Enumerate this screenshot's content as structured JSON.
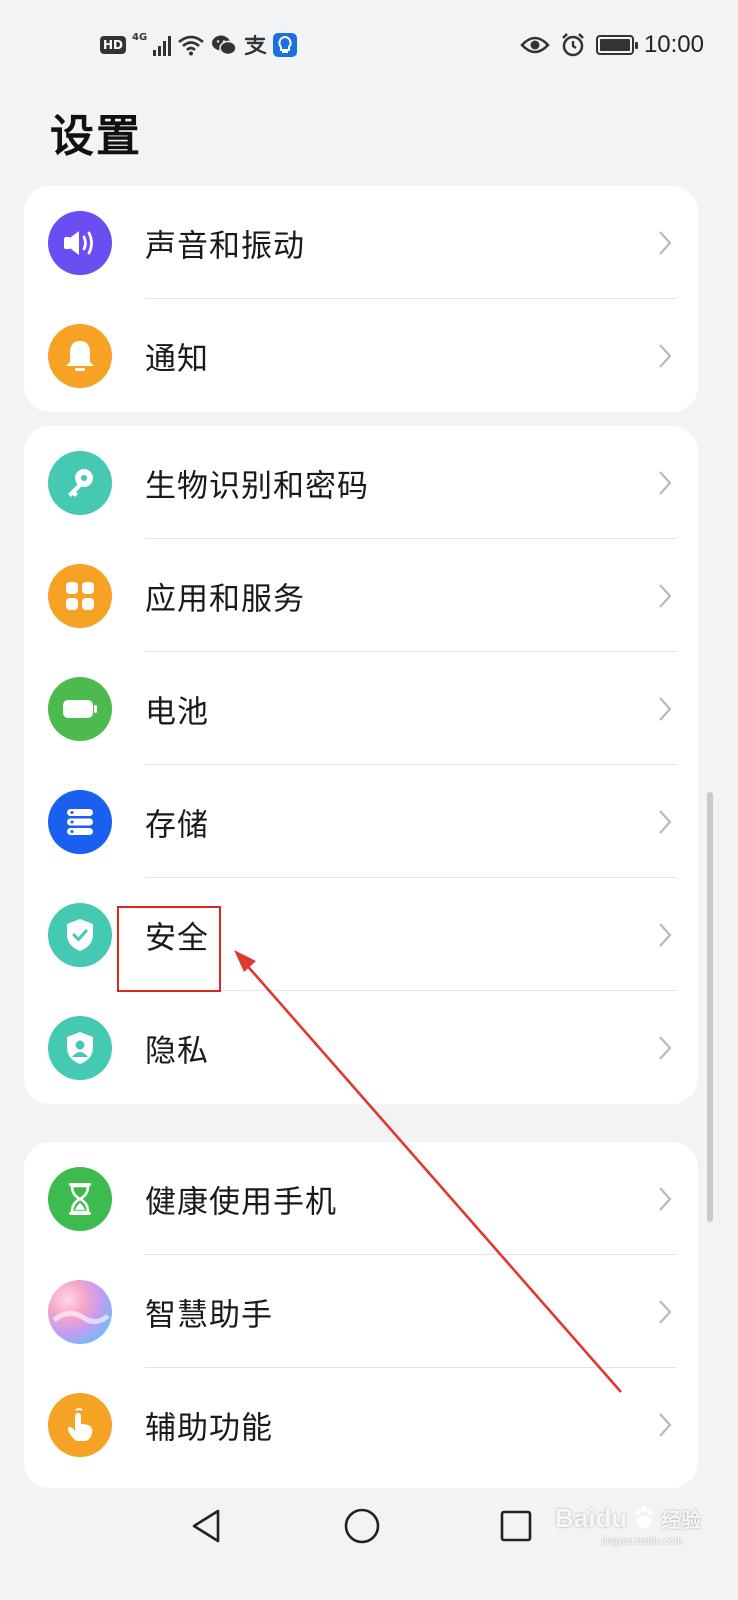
{
  "status_bar": {
    "hd_badge": "HD",
    "network": "4G",
    "time": "10:00"
  },
  "page": {
    "title": "设置"
  },
  "groups": [
    {
      "items": [
        {
          "label": "声音和振动",
          "icon": "speaker-icon",
          "color": "#6a4ef2"
        },
        {
          "label": "通知",
          "icon": "bell-icon",
          "color": "#f6a224"
        }
      ]
    },
    {
      "items": [
        {
          "label": "生物识别和密码",
          "icon": "key-icon",
          "color": "#45c9b3"
        },
        {
          "label": "应用和服务",
          "icon": "apps-icon",
          "color": "#f6a224"
        },
        {
          "label": "电池",
          "icon": "battery-icon",
          "color": "#4cba4f"
        },
        {
          "label": "存储",
          "icon": "storage-icon",
          "color": "#1a5ff0"
        },
        {
          "label": "安全",
          "icon": "shield-check-icon",
          "color": "#45c9b3"
        },
        {
          "label": "隐私",
          "icon": "privacy-shield-icon",
          "color": "#45c9b3"
        }
      ]
    },
    {
      "items": [
        {
          "label": "健康使用手机",
          "icon": "hourglass-icon",
          "color": "#3dbb4e"
        },
        {
          "label": "智慧助手",
          "icon": "assistant-orb-icon",
          "color": "#9aa6f0"
        },
        {
          "label": "辅助功能",
          "icon": "hand-touch-icon",
          "color": "#f6a224"
        }
      ]
    }
  ],
  "annotation": {
    "highlight_color": "#d9281f"
  },
  "watermark": {
    "brand": "Baidu",
    "suffix": "经验",
    "sub": "jingyan.baidu.com"
  }
}
